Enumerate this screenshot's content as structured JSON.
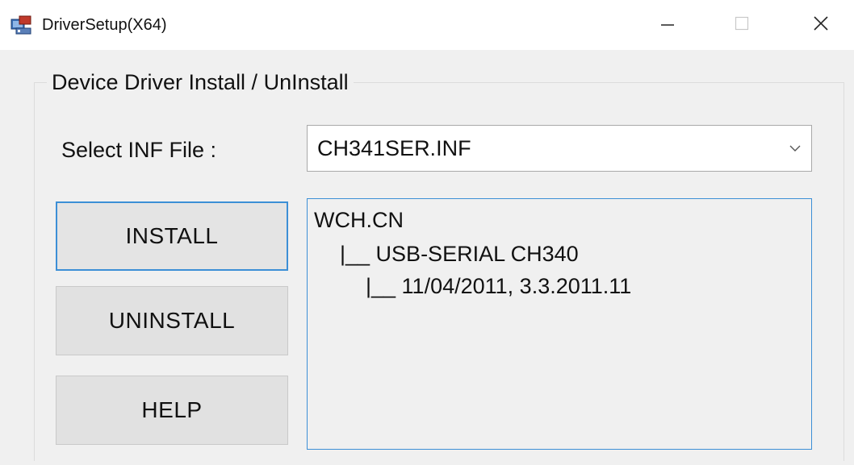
{
  "window": {
    "title": "DriverSetup(X64)",
    "app_icon": "driver-setup-icon",
    "controls": {
      "minimize_icon": "minimize-icon",
      "maximize_icon": "maximize-icon",
      "close_icon": "close-icon"
    }
  },
  "group": {
    "title": "Device Driver Install / UnInstall"
  },
  "inf_select": {
    "label": "Select INF File :",
    "value": "CH341SER.INF",
    "arrow_icon": "chevron-down-icon"
  },
  "buttons": {
    "install": "INSTALL",
    "uninstall": "UNINSTALL",
    "help": "HELP"
  },
  "info_tree": {
    "lines": [
      "WCH.CN",
      "|__ USB-SERIAL CH340",
      "|__ 11/04/2011, 3.3.2011.11"
    ]
  },
  "colors": {
    "focus_border": "#3c8fd6",
    "window_bg": "#f0f0f0",
    "button_bg": "#e1e1e1"
  }
}
